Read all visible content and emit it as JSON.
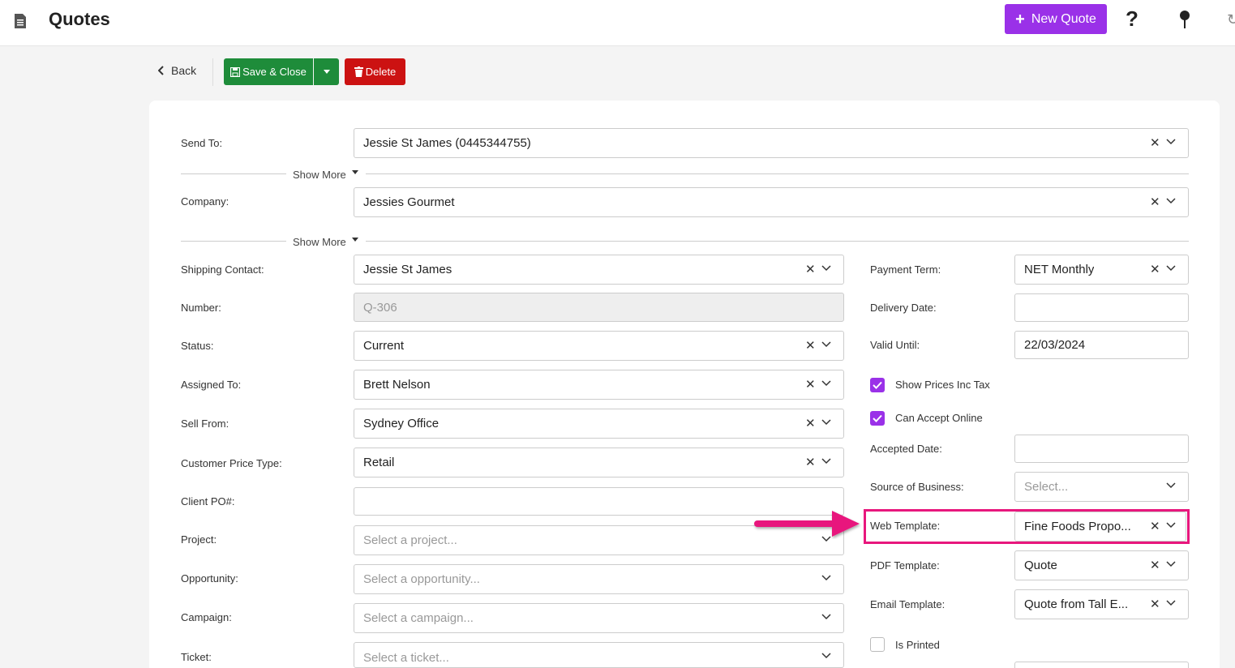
{
  "header": {
    "title": "Quotes",
    "new_quote_label": "New Quote",
    "help_symbol": "?",
    "icons": [
      "document-icon",
      "help-icon",
      "pin-icon",
      "refresh-icon"
    ]
  },
  "toolbar": {
    "back_label": "Back",
    "save_close_label": "Save & Close",
    "delete_label": "Delete"
  },
  "colors": {
    "accent": "#9a31e8",
    "save": "#1e8c3a",
    "delete": "#cc1212",
    "highlight": "#e8177d"
  },
  "form": {
    "send_to": {
      "label": "Send To:",
      "value": "Jessie St James (0445344755)"
    },
    "show_more_1": "Show More",
    "company": {
      "label": "Company:",
      "value": "Jessies Gourmet"
    },
    "show_more_2": "Show More",
    "left": {
      "shipping_contact": {
        "label": "Shipping Contact:",
        "value": "Jessie St James"
      },
      "number": {
        "label": "Number:",
        "value": "Q-306"
      },
      "status": {
        "label": "Status:",
        "value": "Current"
      },
      "assigned_to": {
        "label": "Assigned To:",
        "value": "Brett Nelson"
      },
      "sell_from": {
        "label": "Sell From:",
        "value": "Sydney Office"
      },
      "customer_price_type": {
        "label": "Customer Price Type:",
        "value": "Retail"
      },
      "client_po": {
        "label": "Client PO#:",
        "value": ""
      },
      "project": {
        "label": "Project:",
        "placeholder": "Select a project..."
      },
      "opportunity": {
        "label": "Opportunity:",
        "placeholder": "Select a opportunity..."
      },
      "campaign": {
        "label": "Campaign:",
        "placeholder": "Select a campaign..."
      },
      "ticket": {
        "label": "Ticket:",
        "placeholder": "Select a ticket..."
      }
    },
    "right": {
      "payment_term": {
        "label": "Payment Term:",
        "value": "NET Monthly"
      },
      "delivery_date": {
        "label": "Delivery Date:",
        "value": ""
      },
      "valid_until": {
        "label": "Valid Until:",
        "value": "22/03/2024"
      },
      "show_prices_inc_tax": {
        "label": "Show Prices Inc Tax",
        "checked": true
      },
      "can_accept_online": {
        "label": "Can Accept Online",
        "checked": true
      },
      "accepted_date": {
        "label": "Accepted Date:",
        "value": ""
      },
      "source_of_business": {
        "label": "Source of Business:",
        "placeholder": "Select..."
      },
      "web_template": {
        "label": "Web Template:",
        "value": "Fine Foods Propo..."
      },
      "pdf_template": {
        "label": "PDF Template:",
        "value": "Quote"
      },
      "email_template": {
        "label": "Email Template:",
        "value": "Quote from Tall E..."
      },
      "is_printed": {
        "label": "Is Printed",
        "checked": false
      }
    }
  }
}
